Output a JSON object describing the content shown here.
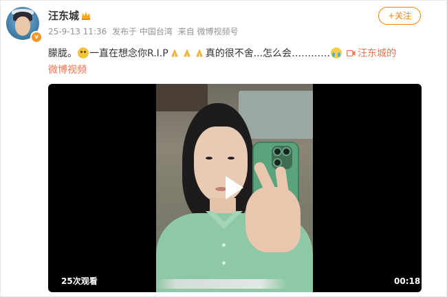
{
  "post": {
    "username": "汪东城",
    "date": "25-9-13 11:36",
    "location": "发布于 中国台湾",
    "source": "来自 微博视频号",
    "follow_label": "+关注",
    "text_part1": "朦胧。",
    "text_part2": "一直在想念你R.I.P",
    "text_part3": "真的很不舍...怎么会",
    "ellipsis": "…………",
    "link_text_line1": "汪东城的",
    "link_text_line2": "微博视频"
  },
  "video": {
    "views": "25次观看",
    "duration": "00:18"
  },
  "icons": {
    "verified": "v-badge-icon",
    "crown": "crown-icon",
    "emoji_sad": "sad-face-icon",
    "emoji_cry": "crying-face-icon",
    "pray": "pray-hands-icon",
    "video_link": "video-icon",
    "play": "play-icon"
  },
  "colors": {
    "accent": "#ff8200",
    "link": "#eb7350",
    "meta": "#939393",
    "text": "#333333"
  }
}
